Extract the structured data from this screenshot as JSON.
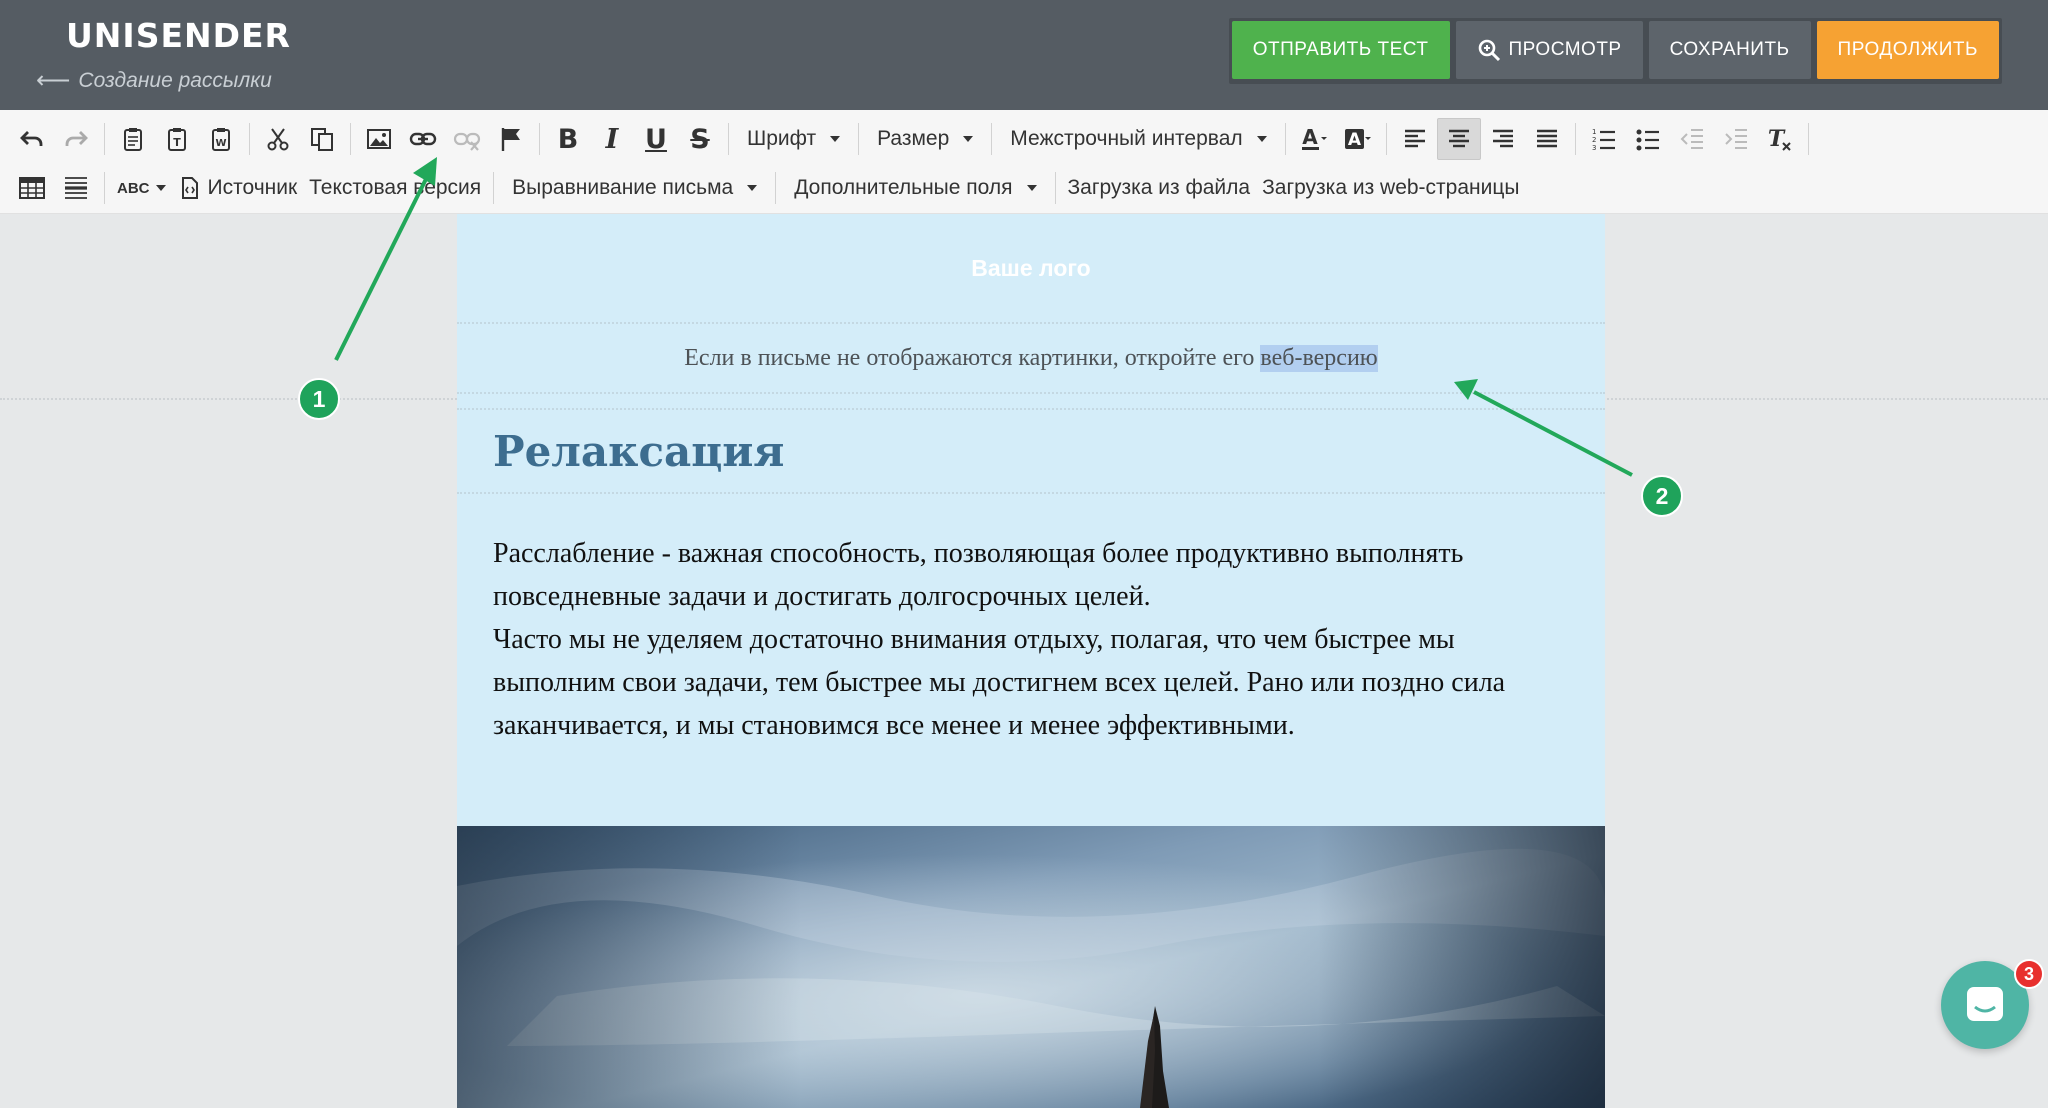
{
  "app": {
    "logo_text": "UNISENDER",
    "back_link": "Создание рассылки"
  },
  "header_buttons": {
    "send_test": "ОТПРАВИТЬ ТЕСТ",
    "preview": "ПРОСМОТР",
    "save": "СОХРАНИТЬ",
    "continue": "ПРОДОЛЖИТЬ"
  },
  "toolbar": {
    "font": "Шрифт",
    "size": "Размер",
    "line_spacing": "Межстрочный интервал",
    "source": "Источник",
    "text_version": "Текстовая версия",
    "email_alignment": "Выравнивание письма",
    "extra_fields": "Дополнительные поля",
    "load_from_file": "Загрузка из файла",
    "load_from_web": "Загрузка из web-страницы",
    "bold_glyph": "B",
    "italic_glyph": "I",
    "underline_glyph": "U",
    "strike_glyph": "S",
    "spellcheck_glyph": "ABC"
  },
  "email": {
    "logo_placeholder": "Ваше лого",
    "preheader_text": "Если в письме не отображаются картинки, откройте его",
    "preheader_link": "веб-версию",
    "title": "Релаксация",
    "paragraph1": "Расслабление - важная способность, позволяющая более продуктивно выполнять повседневные задачи и достигать долгосрочных целей.",
    "paragraph2": "Часто мы не уделяем достаточно внимания отдыху, полагая, что чем быстрее мы выполним свои задачи, тем быстрее мы достигнем всех целей. Рано или поздно сила заканчивается, и мы становимся все менее и менее эффективными."
  },
  "annotations": {
    "badge1": "1",
    "badge2": "2"
  },
  "chat": {
    "unread_count": "3"
  },
  "colors": {
    "header_bg": "#555c63",
    "send_test_green": "#4fb24d",
    "continue_orange": "#f6a233",
    "email_bg": "#d4edf9",
    "title_color": "#3d6d8f",
    "annotation_green": "#1fa35b",
    "chat_teal": "#4fb5a5"
  }
}
